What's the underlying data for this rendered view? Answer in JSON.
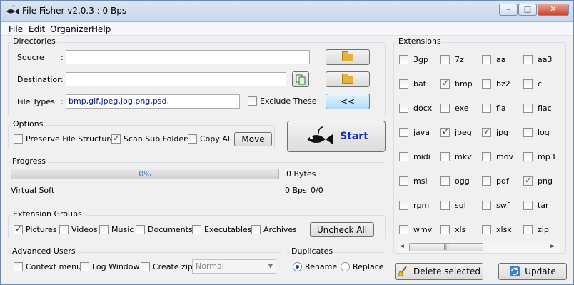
{
  "window": {
    "title": "File Fisher v2.0.3 : 0 Bps",
    "minimize": "–",
    "maximize": "□",
    "close": "✕"
  },
  "menu": [
    "File",
    "Edit",
    "Organizer",
    "Help"
  ],
  "directories": {
    "legend": "Directories",
    "source_label": "Soucre",
    "destination_label": "Destination",
    "colon": ":",
    "filetypes_label": "File Types",
    "filetypes_value": "bmp,gif,jpeg,jpg,png,psd,",
    "exclude_label": "Exclude These",
    "exclude_checked": false,
    "arrow_button": "<<"
  },
  "options": {
    "legend": "Options",
    "preserve": {
      "label": "Preserve File Structure",
      "checked": false
    },
    "scan_sub": {
      "label": "Scan Sub Folders",
      "checked": true
    },
    "copy_all": {
      "label": "Copy All",
      "checked": false
    },
    "move_button": "Move"
  },
  "start_button": "Start",
  "progress": {
    "legend": "Progress",
    "percent_text": "0%",
    "percent": 0,
    "bytes": "0 Bytes",
    "status": "Virtual Soft",
    "rate": "0 Bps",
    "count": "0/0"
  },
  "groups": {
    "legend": "Extension Groups",
    "items": [
      {
        "label": "Pictures",
        "checked": true
      },
      {
        "label": "Videos",
        "checked": false
      },
      {
        "label": "Music",
        "checked": false
      },
      {
        "label": "Documents",
        "checked": false
      },
      {
        "label": "Executables",
        "checked": false
      },
      {
        "label": "Archives",
        "checked": false
      }
    ],
    "uncheck_button": "Uncheck All"
  },
  "advanced": {
    "legend": "Advanced Users",
    "context": {
      "label": "Context menu",
      "checked": false
    },
    "log": {
      "label": "Log Window",
      "checked": false
    },
    "zip": {
      "label": "Create zip",
      "checked": false
    },
    "compression": "Normal"
  },
  "duplicates": {
    "legend": "Duplicates",
    "rename": {
      "label": "Rename",
      "checked": true
    },
    "replace": {
      "label": "Replace",
      "checked": false
    }
  },
  "extensions": {
    "legend": "Extensions",
    "items": [
      {
        "label": "3gp",
        "checked": false
      },
      {
        "label": "7z",
        "checked": false
      },
      {
        "label": "aa",
        "checked": false
      },
      {
        "label": "aa3",
        "checked": false
      },
      {
        "label": "bat",
        "checked": false
      },
      {
        "label": "bmp",
        "checked": true
      },
      {
        "label": "bz2",
        "checked": false
      },
      {
        "label": "c",
        "checked": false
      },
      {
        "label": "docx",
        "checked": false
      },
      {
        "label": "exe",
        "checked": false
      },
      {
        "label": "fla",
        "checked": false
      },
      {
        "label": "flac",
        "checked": false
      },
      {
        "label": "java",
        "checked": false
      },
      {
        "label": "jpeg",
        "checked": true
      },
      {
        "label": "jpg",
        "checked": true
      },
      {
        "label": "log",
        "checked": false
      },
      {
        "label": "midi",
        "checked": false
      },
      {
        "label": "mkv",
        "checked": false
      },
      {
        "label": "mov",
        "checked": false
      },
      {
        "label": "mp3",
        "checked": false
      },
      {
        "label": "msi",
        "checked": false
      },
      {
        "label": "ogg",
        "checked": false
      },
      {
        "label": "pdf",
        "checked": false
      },
      {
        "label": "png",
        "checked": true
      },
      {
        "label": "rpm",
        "checked": false
      },
      {
        "label": "sql",
        "checked": false
      },
      {
        "label": "swf",
        "checked": false
      },
      {
        "label": "tar",
        "checked": false
      },
      {
        "label": "wmv",
        "checked": false
      },
      {
        "label": "xls",
        "checked": false
      },
      {
        "label": "xlsx",
        "checked": false
      },
      {
        "label": "zip",
        "checked": false
      }
    ],
    "scroll_left": "◄",
    "scroll_right": "►",
    "scroll_grip": "|||"
  },
  "bottom": {
    "delete_button": "Delete selected",
    "update_button": "Update"
  }
}
